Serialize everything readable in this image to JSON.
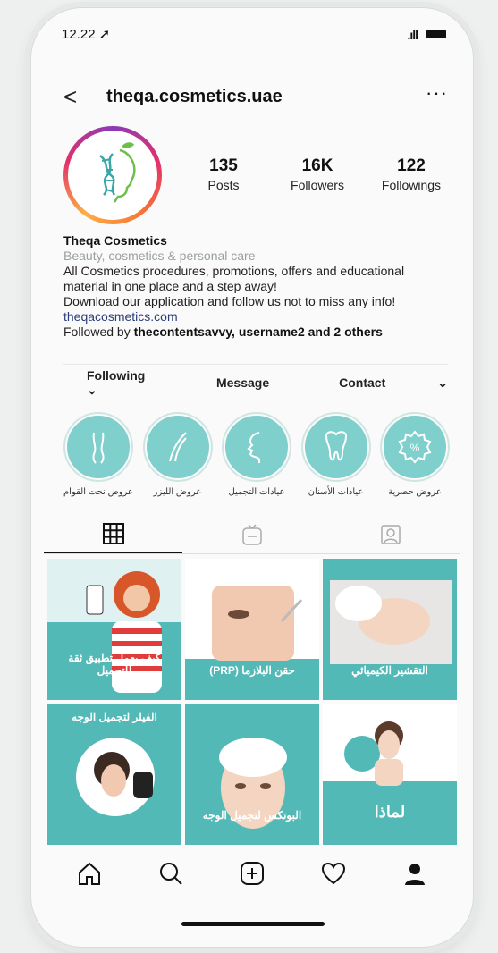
{
  "status": {
    "time": "12.22 ➚",
    "signal": ".ıll"
  },
  "header": {
    "username": "theqa.cosmetics.uae",
    "back": "<",
    "more": "···"
  },
  "stats": [
    {
      "num": "135",
      "label": "Posts"
    },
    {
      "num": "16K",
      "label": "Followers"
    },
    {
      "num": "122",
      "label": "Followings"
    }
  ],
  "bio": {
    "name": "Theqa Cosmetics",
    "category": "Beauty, cosmetics & personal care",
    "line1": "All Cosmetics procedures, promotions, offers and educational",
    "line2": "material in one place and a step away!",
    "line3": "Download our application and follow us not to miss any info!",
    "link": "theqacosmetics.com",
    "followed_prefix": "Followed by ",
    "followed_names": "thecontentsavvy, username2 and 2 others"
  },
  "actions": {
    "following": "Following ⌄",
    "message": "Message",
    "contact": "Contact",
    "more": "⌄"
  },
  "highlights": [
    {
      "label": "عروض نحت القوام"
    },
    {
      "label": "عروض الليزر"
    },
    {
      "label": "عيادات التجميل"
    },
    {
      "label": "عيادات الأسنان"
    },
    {
      "label": "عروض حصرية"
    }
  ],
  "posts": [
    {
      "caption": "كيف يعمل تطبيق ثقة للتجميل"
    },
    {
      "caption": "حقن البلازما (PRP)"
    },
    {
      "caption": "التقشير الكيميائي"
    },
    {
      "caption": "الفيلر لتجميل الوجه"
    },
    {
      "caption": "البوتكس لتجميل الوجه"
    },
    {
      "caption": "لماذا"
    }
  ],
  "colors": {
    "brand_teal": "#53b9b7",
    "highlight": "#7fcfcd"
  }
}
